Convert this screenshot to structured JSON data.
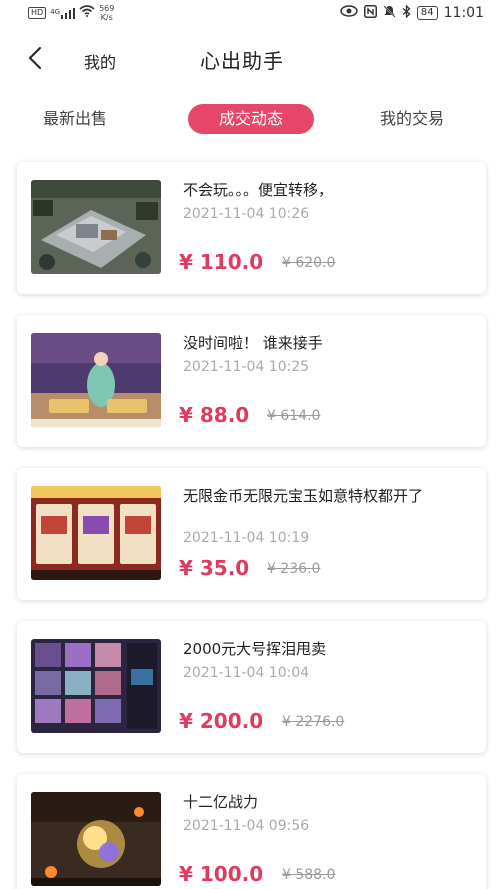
{
  "status_bar": {
    "hd_badge": "HD",
    "signal_label": "4G",
    "net_speed_value": "569",
    "net_speed_unit": "K/s",
    "battery": "84",
    "time": "11:01"
  },
  "nav": {
    "back_icon": "chevron-left-icon",
    "mine_label": "我的",
    "title": "心出助手"
  },
  "tabs": [
    {
      "label": "最新出售",
      "active": false
    },
    {
      "label": "成交动态",
      "active": true
    },
    {
      "label": "我的交易",
      "active": false
    }
  ],
  "accent_color": "#e7466b",
  "price_color": "#e03a5e",
  "listings": [
    {
      "title": "不会玩。。。便宜转移，",
      "date": "2021-11-04 10:26",
      "price": "¥ 110.0",
      "original_price": "¥ 620.0",
      "thumbnail": "game-city-screenshot"
    },
    {
      "title": "没时间啦！ 谁来接手",
      "date": "2021-11-04 10:25",
      "price": "¥ 88.0",
      "original_price": "¥ 614.0",
      "thumbnail": "game-character-screenshot"
    },
    {
      "title": "无限金币无限元宝玉如意特权都开了",
      "date": "2021-11-04 10:19",
      "price": "¥ 35.0",
      "original_price": "¥ 236.0",
      "thumbnail": "game-shop-screenshot"
    },
    {
      "title": "2000元大号挥泪甩卖",
      "date": "2021-11-04 10:04",
      "price": "¥ 200.0",
      "original_price": "¥ 2276.0",
      "thumbnail": "game-inventory-screenshot"
    },
    {
      "title": "十二亿战力",
      "date": "2021-11-04 09:56",
      "price": "¥ 100.0",
      "original_price": "¥ 588.0",
      "thumbnail": "game-battle-screenshot"
    }
  ]
}
